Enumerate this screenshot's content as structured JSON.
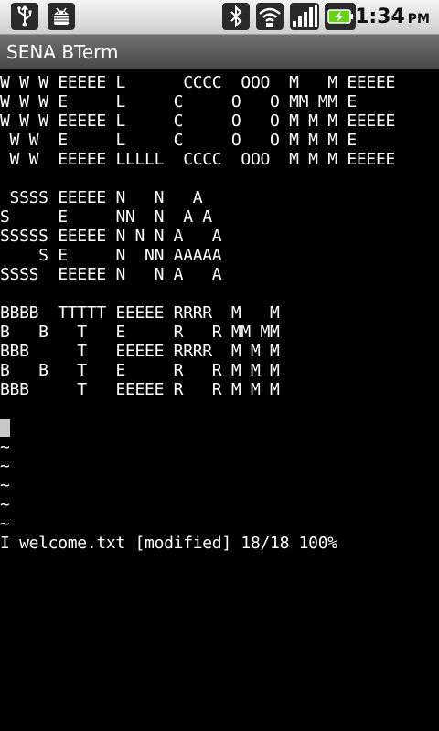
{
  "status_bar": {
    "icons": [
      "usb-icon",
      "android-debug-icon",
      "bluetooth-icon",
      "wifi-icon",
      "signal-icon",
      "battery-charging-icon"
    ],
    "time": "1:34",
    "ampm": "PM"
  },
  "app": {
    "title": "SENA BTerm"
  },
  "terminal": {
    "lines": [
      "W W W EEEEE L      CCCC  OOO  M   M EEEEE",
      "W W W E     L     C     O   O MM MM E",
      "W W W EEEEE L     C     O   O M M M EEEEE",
      " W W  E     L     C     O   O M M M E",
      " W W  EEEEE LLLLL  CCCC  OOO  M M M EEEEE",
      "",
      " SSSS EEEEE N   N   A",
      "S     E     NN  N  A A",
      "SSSSS EEEEE N N N A   A",
      "    S E     N  NN AAAAA",
      "SSSS  EEEEE N   N A   A",
      "",
      "BBBB  TTTTT EEEEE RRRR  M   M",
      "B   B   T   E     R   R MM MM",
      "BBB     T   EEEEE RRRR  M M M",
      "B   B   T   E     R   R M M M",
      "BBB     T   EEEEE R   R M M M",
      "",
      "~",
      "~",
      "~",
      "~",
      "~",
      "I welcome.txt [modified] 18/18 100%"
    ]
  }
}
